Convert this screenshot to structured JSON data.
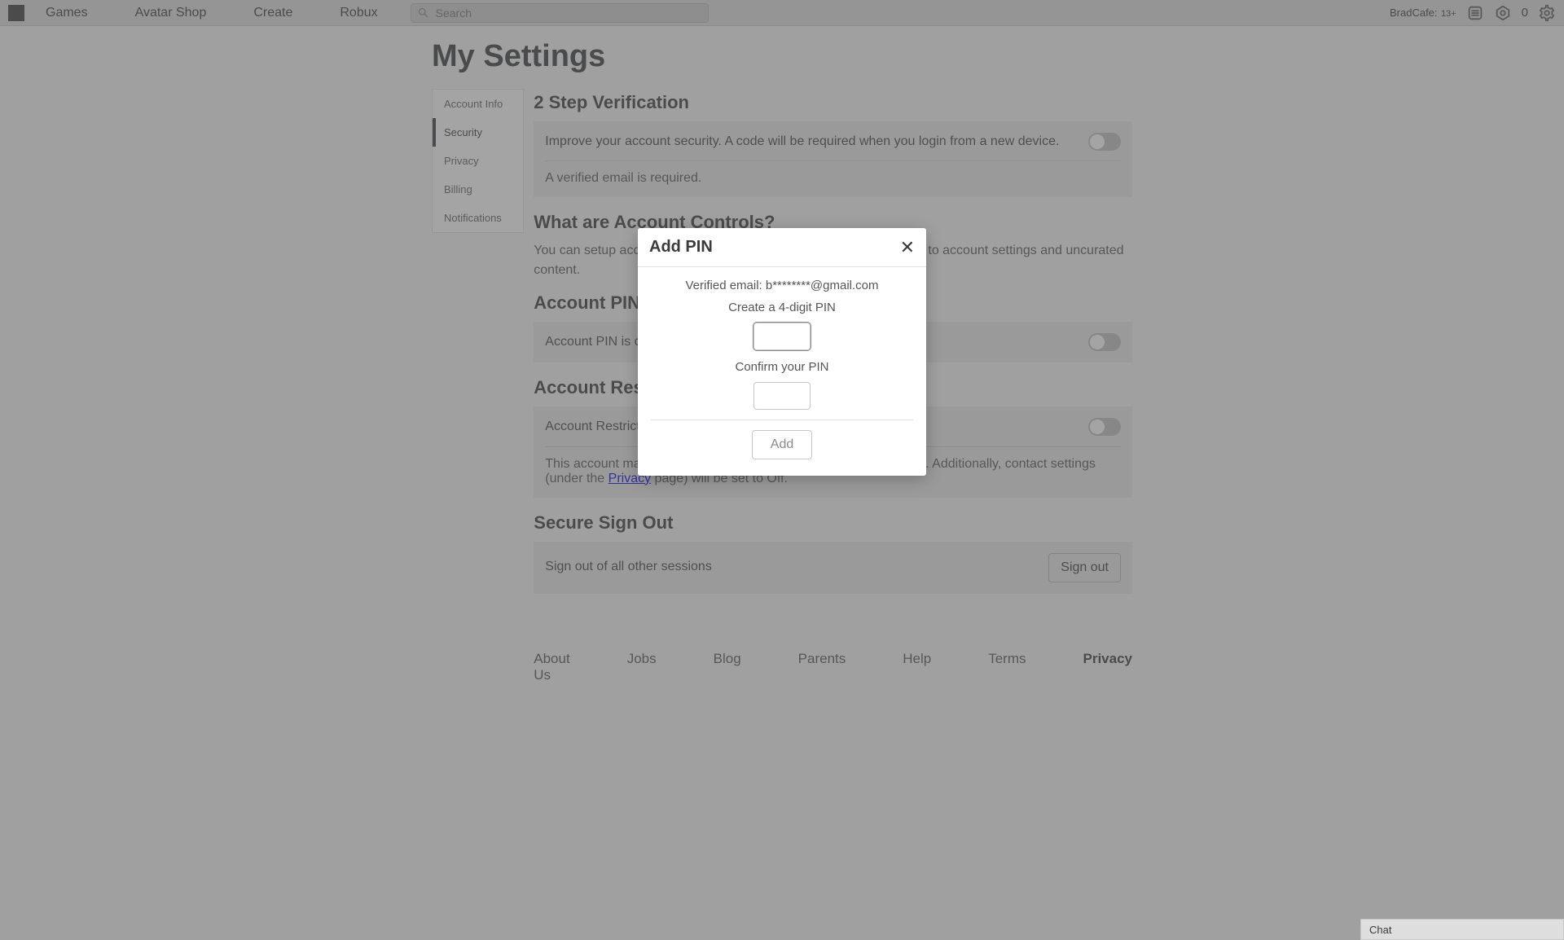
{
  "nav": {
    "links": [
      "Games",
      "Avatar Shop",
      "Create",
      "Robux"
    ],
    "search_placeholder": "Search",
    "username": "BradCafe:",
    "age_tag": "13+",
    "robux_count": "0"
  },
  "page": {
    "title": "My Settings"
  },
  "sidebar": {
    "items": [
      "Account Info",
      "Security",
      "Privacy",
      "Billing",
      "Notifications"
    ],
    "active_index": 1
  },
  "sections": {
    "two_step": {
      "title": "2 Step Verification",
      "desc": "Improve your account security. A code will be required when you login from a new device.",
      "note": "A verified email is required."
    },
    "what_are": {
      "title": "What are Account Controls?",
      "body_a": "You can setup account restrictions on this account to restrict access to account settings and uncurated content."
    },
    "pin": {
      "title": "Account PIN",
      "row_label": "Account PIN is currently disabled"
    },
    "restrictions": {
      "title": "Account Restrictions",
      "row_label": "Account Restrictions is currently disabled",
      "body_b1": "This account may only access our curated content on the platform. Additionally, contact settings (under the ",
      "body_b_link": "Privacy",
      "body_b2": " page) will be set to Off."
    },
    "signout": {
      "title": "Secure Sign Out",
      "desc": "Sign out of all other sessions",
      "button": "Sign out"
    }
  },
  "footer": {
    "links": [
      "About Us",
      "Jobs",
      "Blog",
      "Parents",
      "Help",
      "Terms",
      "Privacy"
    ]
  },
  "chat": {
    "label": "Chat"
  },
  "modal": {
    "title": "Add PIN",
    "verified": "Verified email: b********@gmail.com",
    "create_label": "Create a 4-digit PIN",
    "confirm_label": "Confirm your PIN",
    "add_button": "Add"
  }
}
